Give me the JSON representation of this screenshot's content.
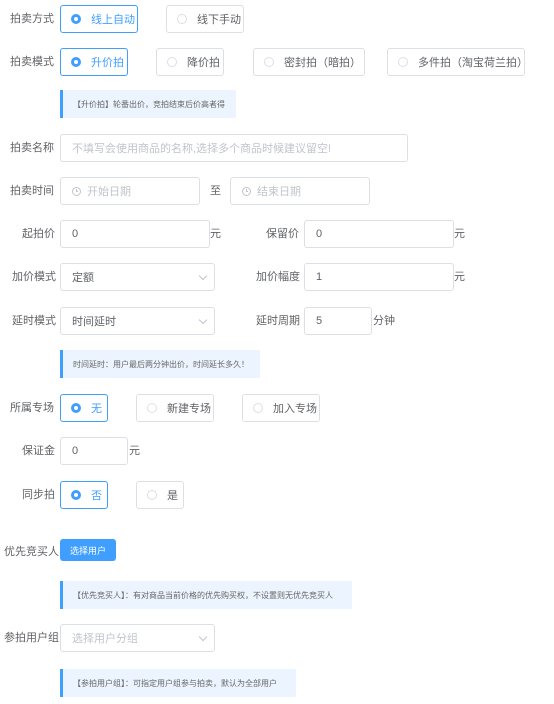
{
  "auction_method": {
    "label": "拍卖方式",
    "options": [
      "线上自动",
      "线下手动"
    ],
    "selected": "线上自动"
  },
  "auction_mode": {
    "label": "拍卖模式",
    "options": [
      "升价拍",
      "降价拍",
      "密封拍（暗拍）",
      "多件拍（淘宝荷兰拍）"
    ],
    "selected": "升价拍",
    "tip": "【升价拍】轮番出价，竞拍结束后价高者得"
  },
  "auction_name": {
    "label": "拍卖名称",
    "placeholder": "不填写会使用商品的名称,选择多个商品时候建议留空!"
  },
  "auction_time": {
    "label": "拍卖时间",
    "start_placeholder": "开始日期",
    "separator": "至",
    "end_placeholder": "结束日期"
  },
  "start_price": {
    "label": "起拍价",
    "value": "0",
    "unit": "元"
  },
  "reserve_price": {
    "label": "保留价",
    "value": "0",
    "unit": "元"
  },
  "increment_mode": {
    "label": "加价模式",
    "value": "定额"
  },
  "increment_amount": {
    "label": "加价幅度",
    "value": "1",
    "unit": "元"
  },
  "delay_mode": {
    "label": "延时模式",
    "value": "时间延时",
    "tip": "时间延时：用户最后两分钟出价，时间延长多久！"
  },
  "delay_period": {
    "label": "延时周期",
    "value": "5",
    "unit": "分钟"
  },
  "special_session": {
    "label": "所属专场",
    "options": [
      "无",
      "新建专场",
      "加入专场"
    ],
    "selected": "无"
  },
  "deposit": {
    "label": "保证金",
    "value": "0",
    "unit": "元"
  },
  "sync_auction": {
    "label": "同步拍",
    "options": [
      "否",
      "是"
    ],
    "selected": "否"
  },
  "priority_buyer": {
    "label": "优先竞买人",
    "button": "选择用户",
    "tip": "【优先竞买人】：有对商品当前价格的优先购买权，不设置则无优先竞买人"
  },
  "user_group": {
    "label": "参拍用户组",
    "placeholder": "选择用户分组",
    "tip": "【参拍用户组】：可指定用户组参与拍卖，默认为全部用户"
  },
  "colors": {
    "primary": "#409eff",
    "tip_bg": "#ecf5ff",
    "border": "#dcdfe6",
    "text": "#606266",
    "placeholder": "#c0c4cc"
  },
  "icons": [
    "clock-icon",
    "chevron-down-icon"
  ]
}
